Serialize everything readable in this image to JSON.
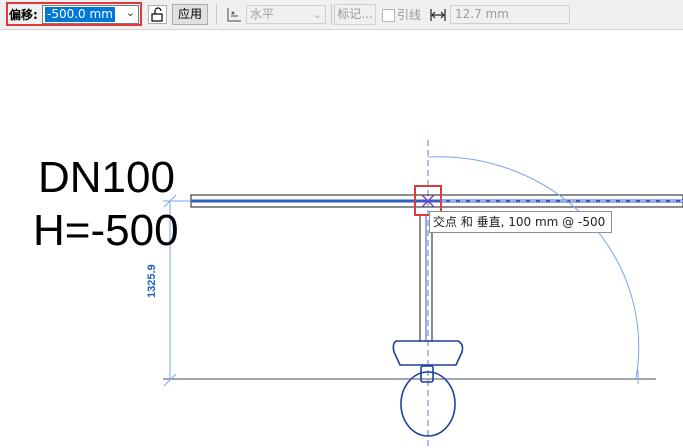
{
  "toolbar": {
    "offset_label": "偏移:",
    "offset_value": "-500.0 mm",
    "apply_label": "应用",
    "orientation_value": "水平",
    "tag_label": "标记...",
    "leader_label": "引线",
    "length_value": "12.7 mm"
  },
  "drawing": {
    "pipe_label_line1": "DN100",
    "pipe_label_line2": "H=-500",
    "dimension_value": "1325.9",
    "snap_tooltip": "交点 和 垂直, 100 mm @ -500"
  },
  "colors": {
    "highlight": "#e0393e",
    "pipe_blue": "#2f5ec9",
    "light_blue": "#7aa6e8",
    "selection": "#0078d7"
  },
  "icons": [
    "chevron-down-icon",
    "lock-icon",
    "orientation-icon",
    "dimension-length-icon",
    "snap-intersection-icon"
  ]
}
